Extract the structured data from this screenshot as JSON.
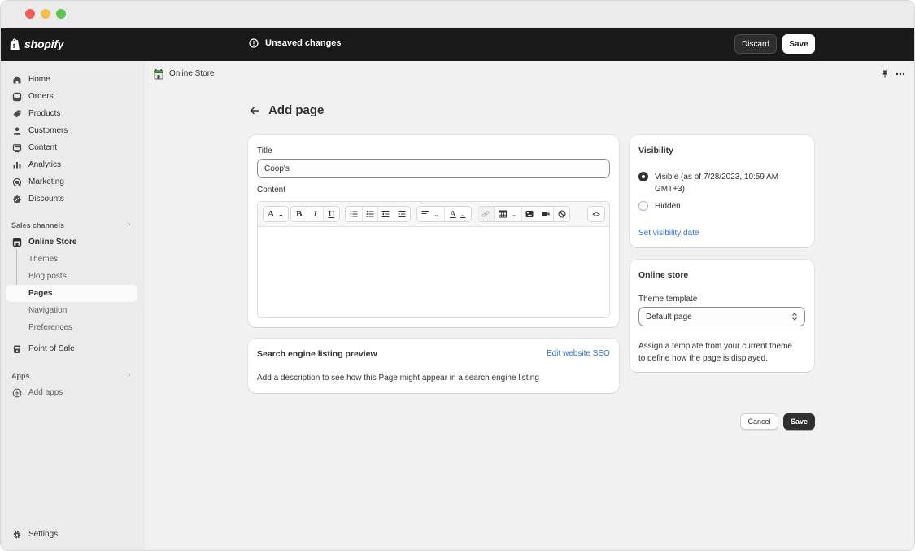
{
  "topbar": {
    "brand": "shopify",
    "status_text": "Unsaved changes",
    "discard_label": "Discard",
    "save_label": "Save"
  },
  "sidebar": {
    "items": [
      {
        "label": "Home",
        "icon": "home-icon"
      },
      {
        "label": "Orders",
        "icon": "inbox-icon"
      },
      {
        "label": "Products",
        "icon": "tag-icon"
      },
      {
        "label": "Customers",
        "icon": "person-icon"
      },
      {
        "label": "Content",
        "icon": "content-icon"
      },
      {
        "label": "Analytics",
        "icon": "bar-chart-icon"
      },
      {
        "label": "Marketing",
        "icon": "target-icon"
      },
      {
        "label": "Discounts",
        "icon": "discount-icon"
      }
    ],
    "sales_channels_label": "Sales channels",
    "online_store": {
      "label": "Online Store",
      "subitems": [
        "Themes",
        "Blog posts",
        "Pages",
        "Navigation",
        "Preferences"
      ]
    },
    "point_of_sale": "Point of Sale",
    "apps_label": "Apps",
    "add_apps": "Add apps",
    "settings": "Settings"
  },
  "subheader": {
    "title": "Online Store"
  },
  "page": {
    "title": "Add page"
  },
  "main_card": {
    "title_label": "Title",
    "title_value": "Coop's",
    "content_label": "Content"
  },
  "seo_card": {
    "title": "Search engine listing preview",
    "edit_link": "Edit website SEO",
    "description": "Add a description to see how this Page might appear in a search engine listing"
  },
  "visibility_card": {
    "title": "Visibility",
    "visible_label": "Visible (as of 7/28/2023, 10:59 AM",
    "visible_label_2": "GMT+3)",
    "hidden_label": "Hidden",
    "set_date_link": "Set visibility date"
  },
  "online_store_card": {
    "title": "Online store",
    "template_label": "Theme template",
    "template_value": "Default page",
    "help_line_1": "Assign a template from your current theme",
    "help_line_2": "to define how the page is displayed."
  },
  "footer": {
    "cancel_label": "Cancel",
    "save_label": "Save"
  }
}
